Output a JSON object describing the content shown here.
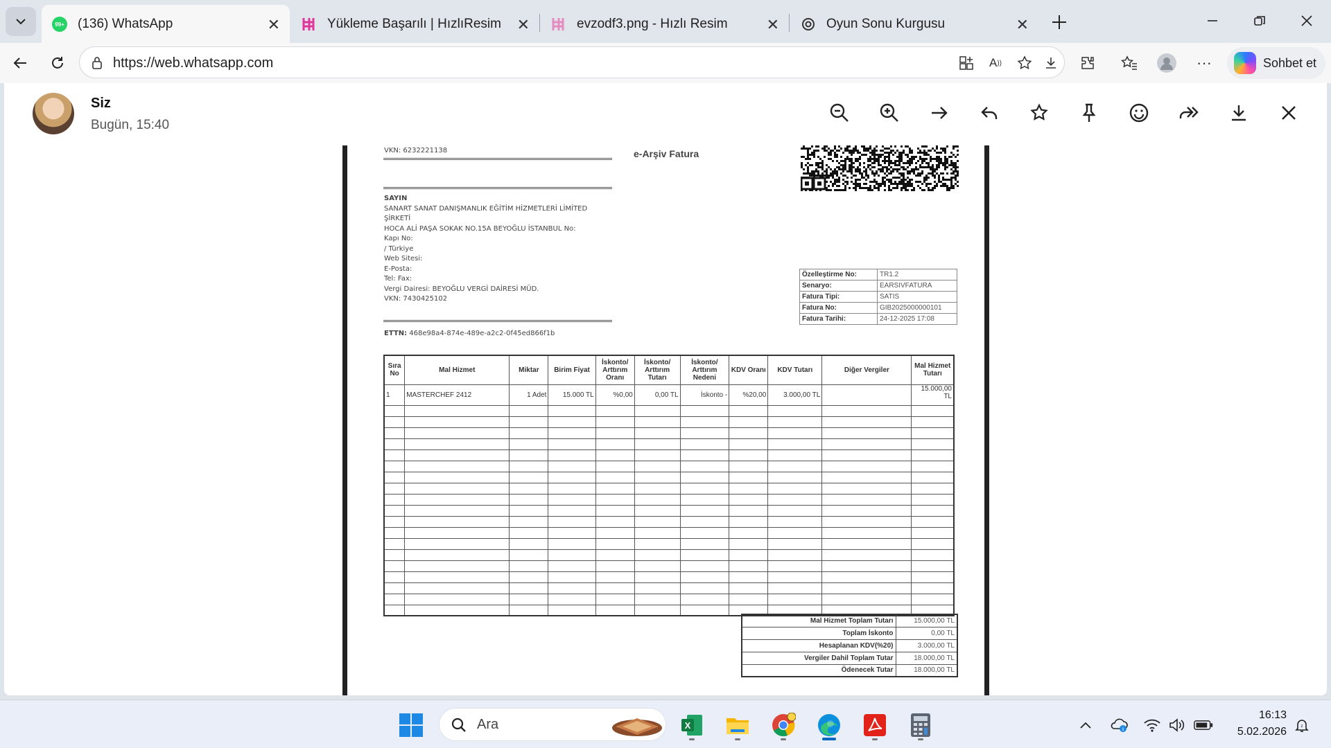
{
  "browser": {
    "tabs": [
      {
        "title": "(136) WhatsApp",
        "badge": "99+",
        "active": true
      },
      {
        "title": "Yükleme Başarılı | HızlıResim",
        "active": false
      },
      {
        "title": "evzodf3.png - Hızlı Resim",
        "active": false
      },
      {
        "title": "Oyun Sonu Kurgusu",
        "active": false
      }
    ],
    "url": "https://web.whatsapp.com",
    "copilot_label": "Sohbet et"
  },
  "viewer": {
    "sender": "Siz",
    "time": "Bugün, 15:40",
    "toolbar_icons": [
      "zoom-out-icon",
      "zoom-in-icon",
      "arrow-right-icon",
      "reply-icon",
      "star-icon",
      "pin-icon",
      "emoji-icon",
      "forward-icon",
      "download-icon",
      "close-icon"
    ]
  },
  "invoice": {
    "seller_vkn": "VKN: 6232221138",
    "title": "e-Arşiv Fatura",
    "buyer_lines": [
      "SAYIN",
      "SANART SANAT DANIŞMANLIK EĞİTİM HİZMETLERİ LİMİTED",
      "ŞİRKETİ",
      "HOCA ALİ PAŞA SOKAK NO.15A BEYOĞLU İSTANBUL  No:",
      "Kapı No:",
      " /  Türkiye",
      "Web Sitesi:",
      "E-Posta:",
      "Tel: Fax:",
      "Vergi Dairesi: BEYOĞLU VERGİ DAİRESİ MÜD.",
      "VKN: 7430425102"
    ],
    "ettn_label": "ETTN:",
    "ettn_value": "468e98a4-874e-489e-a2c2-0f45ed866f1b",
    "meta": [
      {
        "key": "Özelleştirme No:",
        "value": "TR1.2"
      },
      {
        "key": "Senaryo:",
        "value": "EARSIVFATURA"
      },
      {
        "key": "Fatura Tipi:",
        "value": "SATIS"
      },
      {
        "key": "Fatura No:",
        "value": "GIB2025000000101"
      },
      {
        "key": "Fatura Tarihi:",
        "value": "24-12-2025 17:08"
      }
    ],
    "columns": [
      "Sıra No",
      "Mal Hizmet",
      "Miktar",
      "Birim Fiyat",
      "İskonto/ Arttırım Oranı",
      "İskonto/ Arttırım Tutarı",
      "İskonto/ Arttırım Nedeni",
      "KDV Oranı",
      "KDV Tutarı",
      "Diğer Vergiler",
      "Mal Hizmet Tutarı"
    ],
    "rows": [
      [
        "1",
        "MASTERCHEF 2412",
        "1 Adet",
        "15.000 TL",
        "%0,00",
        "0,00 TL",
        "İskonto -",
        "%20,00",
        "3.000,00 TL",
        "",
        "15.000,00 TL"
      ]
    ],
    "empty_rows": 19,
    "totals": [
      {
        "key": "Mal Hizmet Toplam Tutarı",
        "value": "15.000,00 TL"
      },
      {
        "key": "Toplam İskonto",
        "value": "0,00 TL"
      },
      {
        "key": "Hesaplanan KDV(%20)",
        "value": "3.000,00 TL"
      },
      {
        "key": "Vergiler Dahil Toplam Tutar",
        "value": "18.000,00 TL"
      },
      {
        "key": "Ödenecek Tutar",
        "value": "18.000,00 TL"
      }
    ]
  },
  "taskbar": {
    "search_placeholder": "Ara",
    "apps": [
      "start-icon",
      "excel-icon",
      "file-explorer-icon",
      "chrome-icon",
      "edge-icon",
      "acrobat-icon",
      "calculator-icon"
    ],
    "time": "16:13",
    "date": "5.02.2026"
  }
}
